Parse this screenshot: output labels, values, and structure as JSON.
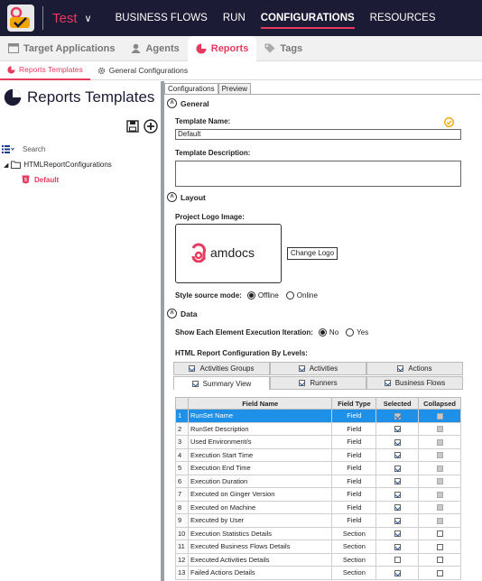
{
  "topbar": {
    "solution_name": "Test",
    "nav": [
      "BUSINESS FLOWS",
      "RUN",
      "CONFIGURATIONS",
      "RESOURCES"
    ],
    "active_nav": "CONFIGURATIONS"
  },
  "main_tabs": [
    "Target Applications",
    "Agents",
    "Reports",
    "Tags"
  ],
  "sub_tabs": [
    "Reports Templates",
    "General Configurations"
  ],
  "left": {
    "title": "Reports Templates",
    "search_placeholder": "Search",
    "tree_root": "HTMLReportConfigurations",
    "tree_child": "Default"
  },
  "right": {
    "tabs": [
      "Configurations",
      "Preview"
    ],
    "general_label": "General",
    "template_name_label": "Template Name:",
    "template_name_value": "Default",
    "template_desc_label": "Template Description:",
    "layout_label": "Layout",
    "logo_label": "Project Logo Image:",
    "logo_text": "amdocs",
    "change_logo": "Change Logo",
    "style_label": "Style source mode:",
    "style_offline": "Offline",
    "style_online": "Online",
    "data_label": "Data",
    "show_iter_label": "Show Each Element Execution Iteration:",
    "no_label": "No",
    "yes_label": "Yes",
    "levels_label": "HTML Report Configuration By Levels:",
    "level_tabs_row1": [
      "Activities Groups",
      "Activities",
      "Actions"
    ],
    "level_tabs_row2": [
      "Summary View",
      "Runners",
      "Business Flows"
    ],
    "grid_headers": [
      "Field Name",
      "Field Type",
      "Selected",
      "Collapsed"
    ],
    "grid_rows": [
      {
        "n": "1",
        "name": "RunSet Name",
        "type": "Field",
        "sel": true,
        "col": false
      },
      {
        "n": "2",
        "name": "RunSet Description",
        "type": "Field",
        "sel": true,
        "col": false
      },
      {
        "n": "3",
        "name": "Used Environment/s",
        "type": "Field",
        "sel": true,
        "col": false
      },
      {
        "n": "4",
        "name": "Execution Start Time",
        "type": "Field",
        "sel": true,
        "col": false
      },
      {
        "n": "5",
        "name": "Execution End Time",
        "type": "Field",
        "sel": true,
        "col": false
      },
      {
        "n": "6",
        "name": "Execution Duration",
        "type": "Field",
        "sel": true,
        "col": false
      },
      {
        "n": "7",
        "name": "Executed on Ginger Version",
        "type": "Field",
        "sel": true,
        "col": false
      },
      {
        "n": "8",
        "name": "Executed on Machine",
        "type": "Field",
        "sel": true,
        "col": false
      },
      {
        "n": "9",
        "name": "Executed by User",
        "type": "Field",
        "sel": true,
        "col": false
      },
      {
        "n": "10",
        "name": "Execution Statistics Details",
        "type": "Section",
        "sel": true,
        "col": false
      },
      {
        "n": "11",
        "name": "Executed Business Flows Details",
        "type": "Section",
        "sel": true,
        "col": false
      },
      {
        "n": "12",
        "name": "Executed Activities Details",
        "type": "Section",
        "sel": false,
        "col": false
      },
      {
        "n": "13",
        "name": "Failed Actions Details",
        "type": "Section",
        "sel": true,
        "col": false
      }
    ]
  },
  "colors": {
    "accent": "#e83a5e",
    "topbar": "#1b1b35",
    "selected_row": "#1e90e8"
  }
}
